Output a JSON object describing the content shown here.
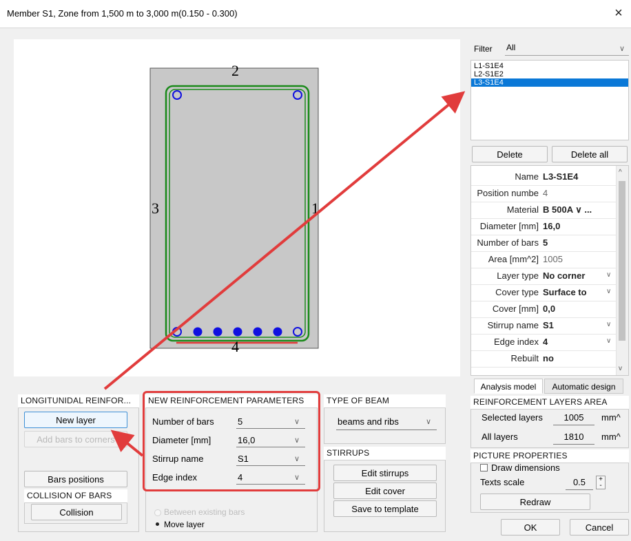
{
  "window": {
    "title": "Member S1, Zone from 1,500 m to 3,000 m(0.150 - 0.300)",
    "close_label": "×"
  },
  "section": {
    "edge_labels": [
      "2",
      "3",
      "1",
      "4"
    ]
  },
  "filter": {
    "label": "Filter",
    "value": "All",
    "items": [
      "L1-S1E4",
      "L2-S1E2",
      "L3-S1E4"
    ],
    "selected_index": 2
  },
  "layer_buttons": {
    "delete": "Delete",
    "delete_all": "Delete all"
  },
  "properties": [
    {
      "key": "Name",
      "value": "L3-S1E4",
      "dropdown": false,
      "muted": false
    },
    {
      "key": "Position numbe",
      "value": "4",
      "dropdown": false,
      "muted": true
    },
    {
      "key": "Material",
      "value": "B 500A ∨ ...",
      "dropdown": false,
      "muted": false
    },
    {
      "key": "Diameter [mm]",
      "value": "16,0",
      "dropdown": false,
      "muted": false
    },
    {
      "key": "Number of bars",
      "value": "5",
      "dropdown": false,
      "muted": false
    },
    {
      "key": "Area [mm^2]",
      "value": "1005",
      "dropdown": false,
      "muted": true
    },
    {
      "key": "Layer type",
      "value": "No corner",
      "dropdown": true,
      "muted": false
    },
    {
      "key": "Cover type",
      "value": "Surface to",
      "dropdown": true,
      "muted": false
    },
    {
      "key": "Cover [mm]",
      "value": "0,0",
      "dropdown": false,
      "muted": false
    },
    {
      "key": "Stirrup name",
      "value": "S1",
      "dropdown": true,
      "muted": false
    },
    {
      "key": "Edge index",
      "value": "4",
      "dropdown": true,
      "muted": false
    },
    {
      "key": "Rebuilt",
      "value": "no",
      "dropdown": false,
      "muted": false
    }
  ],
  "tabs": [
    "Analysis model",
    "Automatic design"
  ],
  "longitudinal": {
    "title": "LONGITUNIDAL REINFOR...",
    "new_layer": "New layer",
    "add_bars_to_corners": "Add bars to corners",
    "bars_positions": "Bars positions",
    "collision_title": "COLLISION OF BARS",
    "collision": "Collision"
  },
  "new_params": {
    "title": "NEW REINFORCEMENT PARAMETERS",
    "rows": [
      {
        "label": "Number of bars",
        "value": "5"
      },
      {
        "label": "Diameter [mm]",
        "value": "16,0"
      },
      {
        "label": "Stirrup name",
        "value": "S1"
      },
      {
        "label": "Edge index",
        "value": "4"
      }
    ],
    "radio_between": "Between existing bars",
    "radio_move": "Move layer"
  },
  "beam_type": {
    "title": "TYPE OF BEAM",
    "value": "beams and ribs"
  },
  "stirrups": {
    "title": "STIRRUPS",
    "edit_stirrups": "Edit stirrups",
    "edit_cover": "Edit cover",
    "save_template": "Save to template"
  },
  "layers_area": {
    "title": "REINFORCEMENT LAYERS AREA",
    "selected_label": "Selected layers",
    "selected_value": "1005",
    "selected_unit": "mm^",
    "all_label": "All layers",
    "all_value": "1810",
    "all_unit": "mm^"
  },
  "picture": {
    "title": "PICTURE PROPERTIES",
    "draw_dimensions": "Draw dimensions",
    "texts_scale_label": "Texts scale",
    "texts_scale_value": "0.5",
    "redraw": "Redraw"
  },
  "dialog": {
    "ok": "OK",
    "cancel": "Cancel"
  },
  "colors": {
    "accent_red": "#e13c3c",
    "selection_blue": "#0a78d7",
    "rebar_blue": "#1010e0",
    "stirrup_green": "#1a8a1a",
    "section_grey": "#c8c8c8"
  }
}
